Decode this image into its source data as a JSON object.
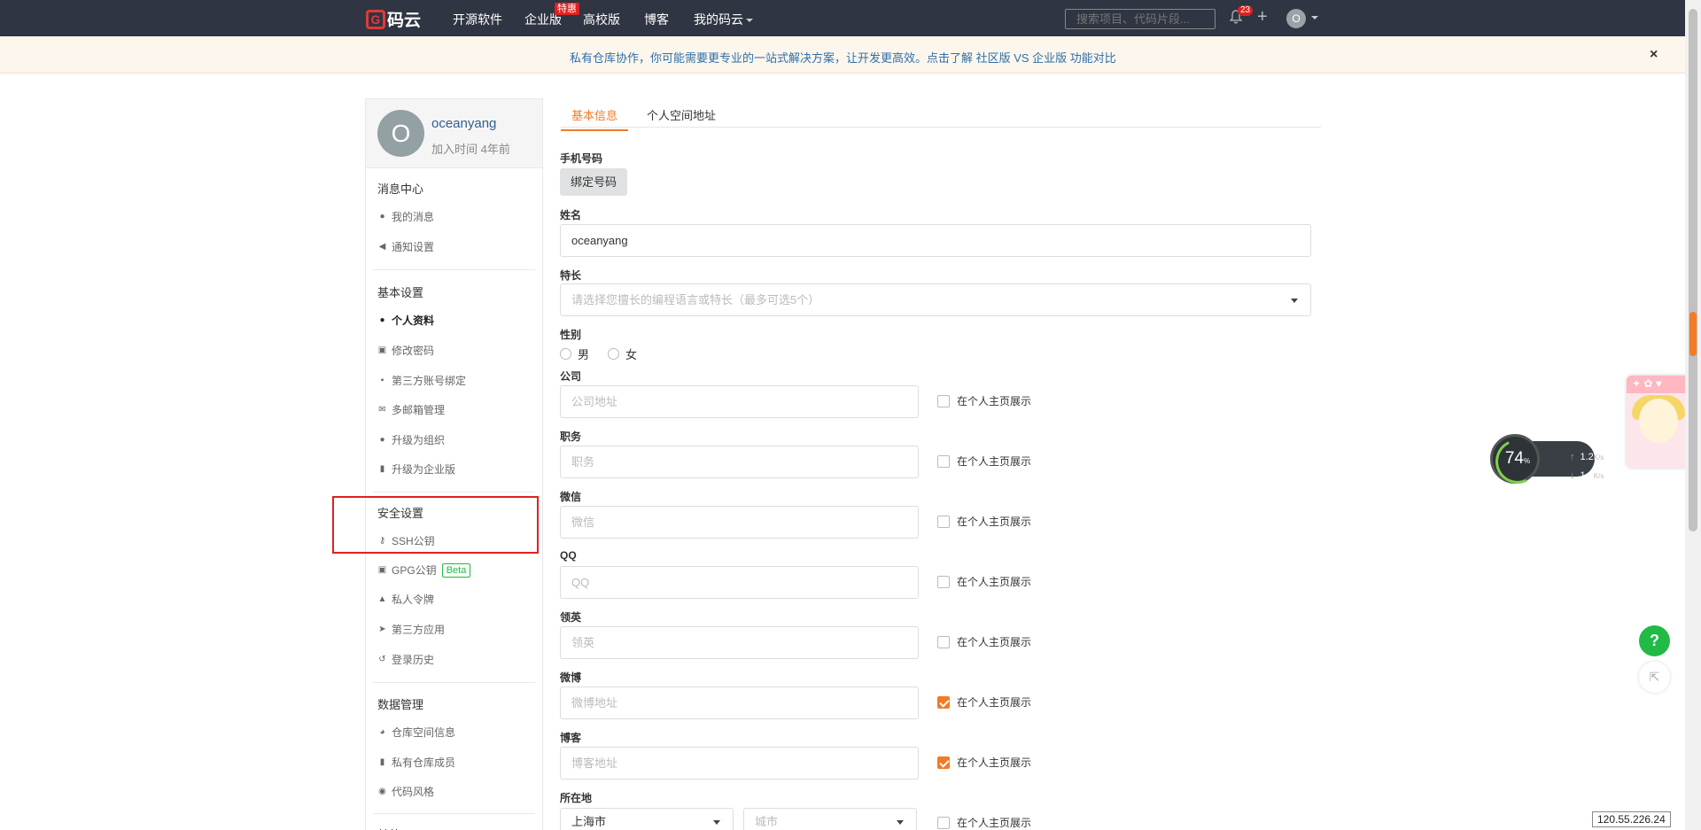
{
  "topnav": {
    "logo": "码云",
    "logo_mark": "G",
    "items": [
      "开源软件",
      "企业版",
      "高校版",
      "博客",
      "我的码云"
    ],
    "enterprise_badge": "特惠",
    "search_placeholder": "搜索项目、代码片段...",
    "notification_count": "23",
    "avatar_initial": "O"
  },
  "notice": {
    "text": "私有仓库协作，你可能需要更专业的一站式解决方案，让开发更高效。点击了解 社区版 VS 企业版 功能对比",
    "close": "×"
  },
  "profile": {
    "avatar_initial": "O",
    "username": "oceanyang",
    "joined": "加入时间 4年前"
  },
  "sidebar": {
    "message_center": "消息中心",
    "my_messages": "我的消息",
    "notify_settings": "通知设置",
    "basic_settings": "基本设置",
    "personal_profile": "个人资料",
    "change_password": "修改密码",
    "third_party_binding": "第三方账号绑定",
    "multi_email": "多邮箱管理",
    "upgrade_org": "升级为组织",
    "upgrade_enterprise": "升级为企业版",
    "security_settings": "安全设置",
    "ssh_key": "SSH公钥",
    "gpg_key": "GPG公钥",
    "beta": "Beta",
    "private_token": "私人令牌",
    "third_party_apps": "第三方应用",
    "login_history": "登录历史",
    "data_management": "数据管理",
    "repo_space": "仓库空间信息",
    "private_members": "私有仓库成员",
    "code_style": "代码风格",
    "other": "其他"
  },
  "tabs": {
    "basic_info": "基本信息",
    "personal_space": "个人空间地址"
  },
  "form": {
    "phone_label": "手机号码",
    "bind_phone_button": "绑定号码",
    "name_label": "姓名",
    "name_value": "oceanyang",
    "specialty_label": "特长",
    "specialty_placeholder": "请选择您擅长的编程语言或特长（最多可选5个）",
    "gender_label": "性别",
    "male": "男",
    "female": "女",
    "company_label": "公司",
    "company_placeholder": "公司地址",
    "position_label": "职务",
    "position_placeholder": "职务",
    "wechat_label": "微信",
    "wechat_placeholder": "微信",
    "qq_label": "QQ",
    "qq_placeholder": "QQ",
    "linkedin_label": "领英",
    "linkedin_placeholder": "领英",
    "weibo_label": "微博",
    "weibo_placeholder": "微博地址",
    "blog_label": "博客",
    "blog_placeholder": "博客地址",
    "location_label": "所在地",
    "province_value": "上海市",
    "city_placeholder": "城市",
    "show_on_homepage": "在个人主页展示",
    "show_flags": {
      "company": false,
      "position": false,
      "wechat": false,
      "qq": false,
      "linkedin": false,
      "weibo": true,
      "blog": true,
      "location": false
    }
  },
  "widgets": {
    "speed_percent": "74",
    "speed_percent_unit": "%",
    "upload_speed": "1.2",
    "download_speed": "1.3",
    "speed_unit": "K/s",
    "help": "?",
    "ip": "120.55.226.24"
  },
  "colors": {
    "accent": "#f27b26",
    "nav_bg": "#2f3542",
    "highlight_box": "#e02020",
    "help_green": "#21ba45"
  }
}
